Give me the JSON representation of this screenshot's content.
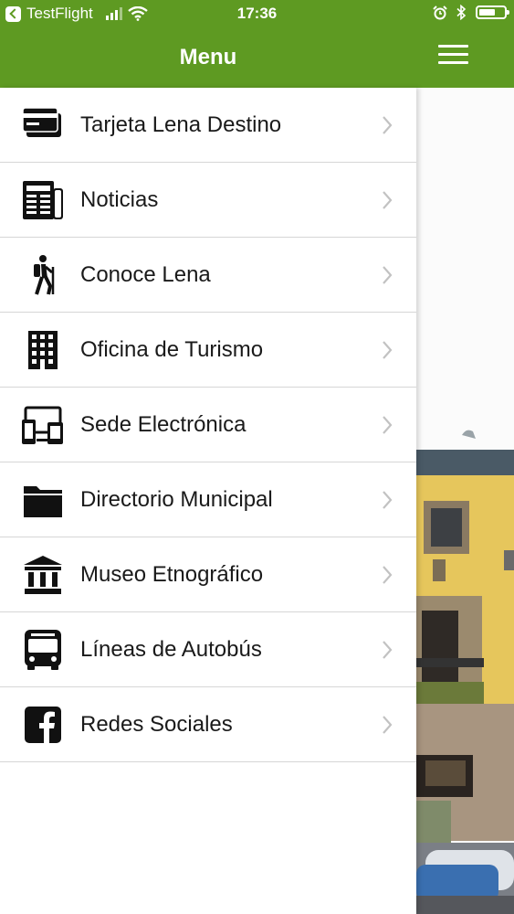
{
  "status_bar": {
    "back_app": "TestFlight",
    "time": "17:36"
  },
  "nav": {
    "title": "Menu"
  },
  "menu": {
    "items": [
      {
        "label": "Tarjeta Lena Destino",
        "icon": "credit-card-icon"
      },
      {
        "label": "Noticias",
        "icon": "newspaper-icon"
      },
      {
        "label": "Conoce Lena",
        "icon": "hiker-icon"
      },
      {
        "label": "Oficina de Turismo",
        "icon": "building-icon"
      },
      {
        "label": "Sede Electrónica",
        "icon": "devices-icon"
      },
      {
        "label": "Directorio Municipal",
        "icon": "folder-icon"
      },
      {
        "label": "Museo Etnográfico",
        "icon": "museum-icon"
      },
      {
        "label": "Líneas de Autobús",
        "icon": "bus-icon"
      },
      {
        "label": "Redes Sociales",
        "icon": "facebook-icon"
      }
    ]
  },
  "colors": {
    "brand_green": "#5e9a22"
  }
}
